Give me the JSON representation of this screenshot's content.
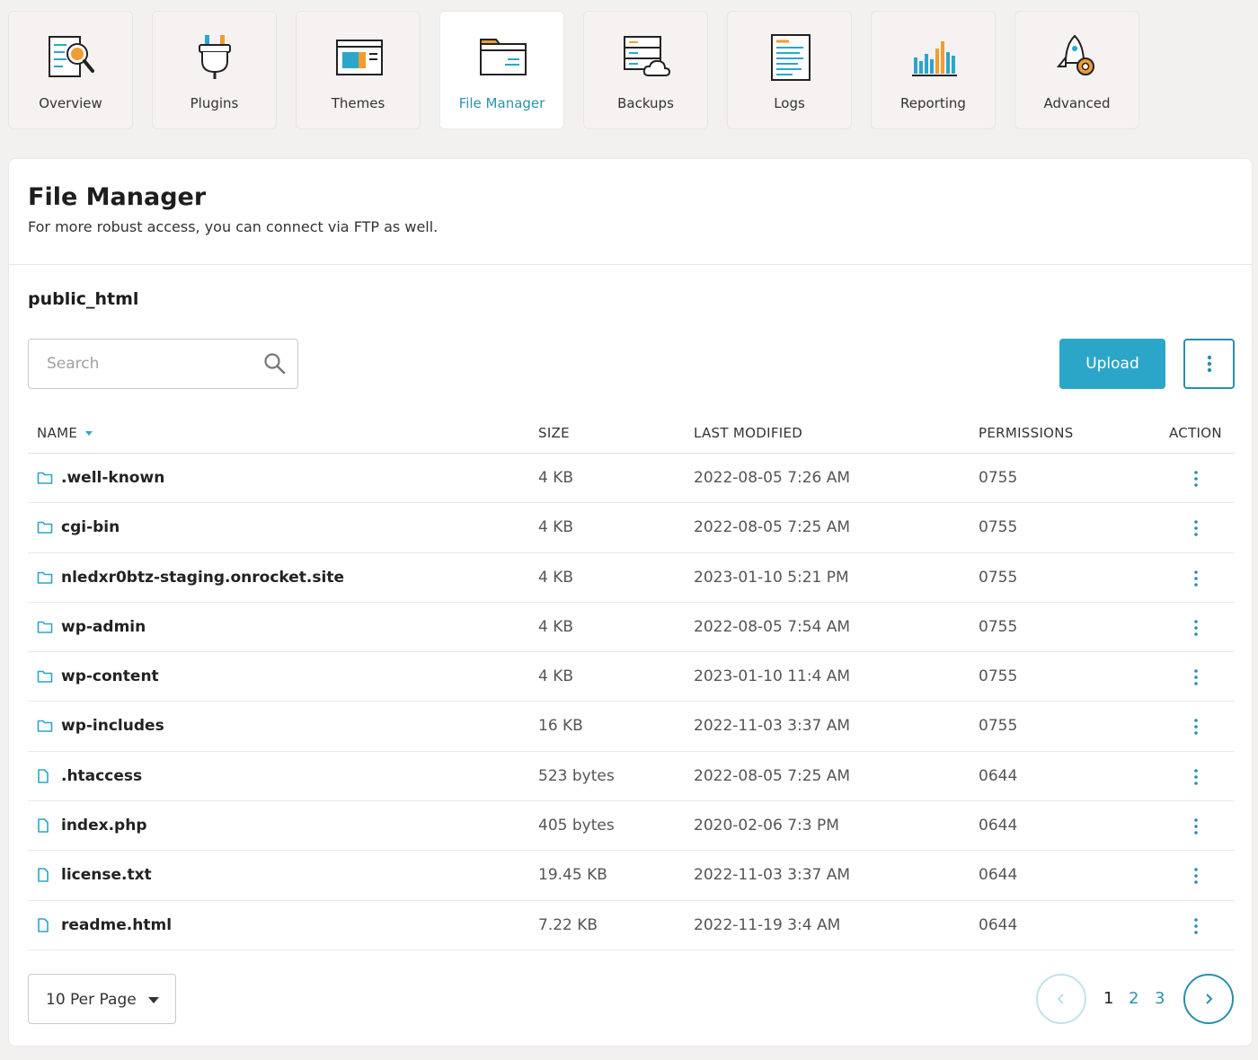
{
  "tabs": [
    {
      "label": "Overview",
      "icon": "overview-icon",
      "active": false
    },
    {
      "label": "Plugins",
      "icon": "plugin-icon",
      "active": false
    },
    {
      "label": "Themes",
      "icon": "themes-icon",
      "active": false
    },
    {
      "label": "File Manager",
      "icon": "folder-icon",
      "active": true
    },
    {
      "label": "Backups",
      "icon": "backup-server-icon",
      "active": false
    },
    {
      "label": "Logs",
      "icon": "log-document-icon",
      "active": false
    },
    {
      "label": "Reporting",
      "icon": "bar-chart-icon",
      "active": false
    },
    {
      "label": "Advanced",
      "icon": "rocket-gear-icon",
      "active": false
    }
  ],
  "header": {
    "title": "File Manager",
    "subtitle": "For more robust access, you can connect via FTP as well."
  },
  "directory": "public_html",
  "search": {
    "placeholder": "Search",
    "value": ""
  },
  "toolbar": {
    "upload_label": "Upload"
  },
  "table": {
    "columns": {
      "name": "NAME",
      "size": "SIZE",
      "modified": "LAST MODIFIED",
      "permissions": "PERMISSIONS",
      "action": "ACTION"
    },
    "rows": [
      {
        "type": "folder",
        "name": ".well-known",
        "size": "4 KB",
        "modified": "2022-08-05 7:26 AM",
        "permissions": "0755"
      },
      {
        "type": "folder",
        "name": "cgi-bin",
        "size": "4 KB",
        "modified": "2022-08-05 7:25 AM",
        "permissions": "0755"
      },
      {
        "type": "folder",
        "name": "nledxr0btz-staging.onrocket.site",
        "size": "4 KB",
        "modified": "2023-01-10 5:21 PM",
        "permissions": "0755"
      },
      {
        "type": "folder",
        "name": "wp-admin",
        "size": "4 KB",
        "modified": "2022-08-05 7:54 AM",
        "permissions": "0755"
      },
      {
        "type": "folder",
        "name": "wp-content",
        "size": "4 KB",
        "modified": "2023-01-10 11:4 AM",
        "permissions": "0755"
      },
      {
        "type": "folder",
        "name": "wp-includes",
        "size": "16 KB",
        "modified": "2022-11-03 3:37 AM",
        "permissions": "0755"
      },
      {
        "type": "file",
        "name": ".htaccess",
        "size": "523 bytes",
        "modified": "2022-08-05 7:25 AM",
        "permissions": "0644"
      },
      {
        "type": "file",
        "name": "index.php",
        "size": "405 bytes",
        "modified": "2020-02-06 7:3 PM",
        "permissions": "0644"
      },
      {
        "type": "file",
        "name": "license.txt",
        "size": "19.45 KB",
        "modified": "2022-11-03 3:37 AM",
        "permissions": "0644"
      },
      {
        "type": "file",
        "name": "readme.html",
        "size": "7.22 KB",
        "modified": "2022-11-19 3:4 AM",
        "permissions": "0644"
      }
    ]
  },
  "pagination": {
    "per_page_label": "10 Per Page",
    "pages": [
      "1",
      "2",
      "3"
    ],
    "current": "1"
  },
  "colors": {
    "accent": "#2ba6c9",
    "accent_dark": "#2a8fab",
    "orange": "#f39c32",
    "background": "#f3f1f0"
  }
}
